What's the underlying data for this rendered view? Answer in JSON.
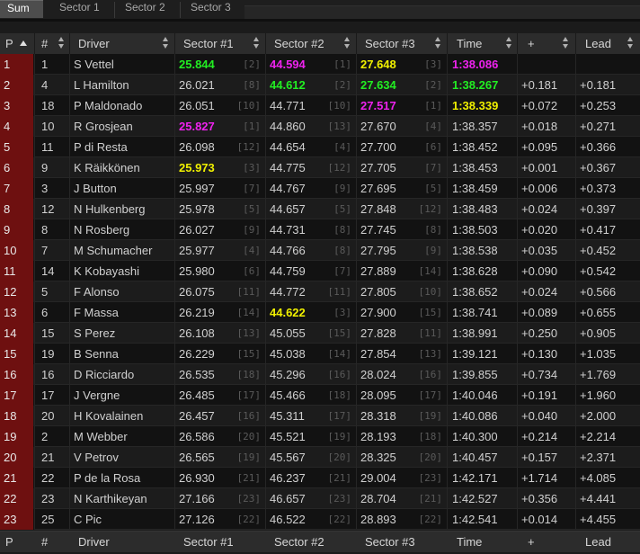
{
  "tabs": [
    "Sum",
    "Sector 1",
    "Sector 2",
    "Sector 3"
  ],
  "headers": {
    "p": "P",
    "num": "#",
    "driver": "Driver",
    "s1": "Sector #1",
    "s2": "Sector #2",
    "s3": "Sector #3",
    "time": "Time",
    "plus": "+",
    "lead": "Lead"
  },
  "colors": {
    "session_best": "#ee22ee",
    "personal_best": "#22ee22",
    "sector_yellow": "#f0f000",
    "position_bg": "#6e1010"
  },
  "rows": [
    {
      "p": "1",
      "num": "1",
      "driver": "S Vettel",
      "s1": "25.844",
      "s1r": "[2]",
      "s1c": "green",
      "s2": "44.594",
      "s2r": "[1]",
      "s2c": "purple",
      "s3": "27.648",
      "s3r": "[3]",
      "s3c": "yellow",
      "time": "1:38.086",
      "tc": "purple",
      "plus": "",
      "lead": ""
    },
    {
      "p": "2",
      "num": "4",
      "driver": "L Hamilton",
      "s1": "26.021",
      "s1r": "[8]",
      "s1c": "",
      "s2": "44.612",
      "s2r": "[2]",
      "s2c": "green",
      "s3": "27.634",
      "s3r": "[2]",
      "s3c": "green",
      "time": "1:38.267",
      "tc": "green",
      "plus": "+0.181",
      "lead": "+0.181"
    },
    {
      "p": "3",
      "num": "18",
      "driver": "P Maldonado",
      "s1": "26.051",
      "s1r": "[10]",
      "s1c": "",
      "s2": "44.771",
      "s2r": "[10]",
      "s2c": "",
      "s3": "27.517",
      "s3r": "[1]",
      "s3c": "purple",
      "time": "1:38.339",
      "tc": "yellow",
      "plus": "+0.072",
      "lead": "+0.253"
    },
    {
      "p": "4",
      "num": "10",
      "driver": "R Grosjean",
      "s1": "25.827",
      "s1r": "[1]",
      "s1c": "purple",
      "s2": "44.860",
      "s2r": "[13]",
      "s2c": "",
      "s3": "27.670",
      "s3r": "[4]",
      "s3c": "",
      "time": "1:38.357",
      "tc": "",
      "plus": "+0.018",
      "lead": "+0.271"
    },
    {
      "p": "5",
      "num": "11",
      "driver": "P di Resta",
      "s1": "26.098",
      "s1r": "[12]",
      "s1c": "",
      "s2": "44.654",
      "s2r": "[4]",
      "s2c": "",
      "s3": "27.700",
      "s3r": "[6]",
      "s3c": "",
      "time": "1:38.452",
      "tc": "",
      "plus": "+0.095",
      "lead": "+0.366"
    },
    {
      "p": "6",
      "num": "9",
      "driver": "K Räikkönen",
      "s1": "25.973",
      "s1r": "[3]",
      "s1c": "yellow",
      "s2": "44.775",
      "s2r": "[12]",
      "s2c": "",
      "s3": "27.705",
      "s3r": "[7]",
      "s3c": "",
      "time": "1:38.453",
      "tc": "",
      "plus": "+0.001",
      "lead": "+0.367"
    },
    {
      "p": "7",
      "num": "3",
      "driver": "J Button",
      "s1": "25.997",
      "s1r": "[7]",
      "s1c": "",
      "s2": "44.767",
      "s2r": "[9]",
      "s2c": "",
      "s3": "27.695",
      "s3r": "[5]",
      "s3c": "",
      "time": "1:38.459",
      "tc": "",
      "plus": "+0.006",
      "lead": "+0.373"
    },
    {
      "p": "8",
      "num": "12",
      "driver": "N Hulkenberg",
      "s1": "25.978",
      "s1r": "[5]",
      "s1c": "",
      "s2": "44.657",
      "s2r": "[5]",
      "s2c": "",
      "s3": "27.848",
      "s3r": "[12]",
      "s3c": "",
      "time": "1:38.483",
      "tc": "",
      "plus": "+0.024",
      "lead": "+0.397"
    },
    {
      "p": "9",
      "num": "8",
      "driver": "N Rosberg",
      "s1": "26.027",
      "s1r": "[9]",
      "s1c": "",
      "s2": "44.731",
      "s2r": "[8]",
      "s2c": "",
      "s3": "27.745",
      "s3r": "[8]",
      "s3c": "",
      "time": "1:38.503",
      "tc": "",
      "plus": "+0.020",
      "lead": "+0.417"
    },
    {
      "p": "10",
      "num": "7",
      "driver": "M Schumacher",
      "s1": "25.977",
      "s1r": "[4]",
      "s1c": "",
      "s2": "44.766",
      "s2r": "[8]",
      "s2c": "",
      "s3": "27.795",
      "s3r": "[9]",
      "s3c": "",
      "time": "1:38.538",
      "tc": "",
      "plus": "+0.035",
      "lead": "+0.452"
    },
    {
      "p": "11",
      "num": "14",
      "driver": "K Kobayashi",
      "s1": "25.980",
      "s1r": "[6]",
      "s1c": "",
      "s2": "44.759",
      "s2r": "[7]",
      "s2c": "",
      "s3": "27.889",
      "s3r": "[14]",
      "s3c": "",
      "time": "1:38.628",
      "tc": "",
      "plus": "+0.090",
      "lead": "+0.542"
    },
    {
      "p": "12",
      "num": "5",
      "driver": "F Alonso",
      "s1": "26.075",
      "s1r": "[11]",
      "s1c": "",
      "s2": "44.772",
      "s2r": "[11]",
      "s2c": "",
      "s3": "27.805",
      "s3r": "[10]",
      "s3c": "",
      "time": "1:38.652",
      "tc": "",
      "plus": "+0.024",
      "lead": "+0.566"
    },
    {
      "p": "13",
      "num": "6",
      "driver": "F Massa",
      "s1": "26.219",
      "s1r": "[14]",
      "s1c": "",
      "s2": "44.622",
      "s2r": "[3]",
      "s2c": "yellow",
      "s3": "27.900",
      "s3r": "[15]",
      "s3c": "",
      "time": "1:38.741",
      "tc": "",
      "plus": "+0.089",
      "lead": "+0.655"
    },
    {
      "p": "14",
      "num": "15",
      "driver": "S Perez",
      "s1": "26.108",
      "s1r": "[13]",
      "s1c": "",
      "s2": "45.055",
      "s2r": "[15]",
      "s2c": "",
      "s3": "27.828",
      "s3r": "[11]",
      "s3c": "",
      "time": "1:38.991",
      "tc": "",
      "plus": "+0.250",
      "lead": "+0.905"
    },
    {
      "p": "15",
      "num": "19",
      "driver": "B Senna",
      "s1": "26.229",
      "s1r": "[15]",
      "s1c": "",
      "s2": "45.038",
      "s2r": "[14]",
      "s2c": "",
      "s3": "27.854",
      "s3r": "[13]",
      "s3c": "",
      "time": "1:39.121",
      "tc": "",
      "plus": "+0.130",
      "lead": "+1.035"
    },
    {
      "p": "16",
      "num": "16",
      "driver": "D Ricciardo",
      "s1": "26.535",
      "s1r": "[18]",
      "s1c": "",
      "s2": "45.296",
      "s2r": "[16]",
      "s2c": "",
      "s3": "28.024",
      "s3r": "[16]",
      "s3c": "",
      "time": "1:39.855",
      "tc": "",
      "plus": "+0.734",
      "lead": "+1.769"
    },
    {
      "p": "17",
      "num": "17",
      "driver": "J Vergne",
      "s1": "26.485",
      "s1r": "[17]",
      "s1c": "",
      "s2": "45.466",
      "s2r": "[18]",
      "s2c": "",
      "s3": "28.095",
      "s3r": "[17]",
      "s3c": "",
      "time": "1:40.046",
      "tc": "",
      "plus": "+0.191",
      "lead": "+1.960"
    },
    {
      "p": "18",
      "num": "20",
      "driver": "H Kovalainen",
      "s1": "26.457",
      "s1r": "[16]",
      "s1c": "",
      "s2": "45.311",
      "s2r": "[17]",
      "s2c": "",
      "s3": "28.318",
      "s3r": "[19]",
      "s3c": "",
      "time": "1:40.086",
      "tc": "",
      "plus": "+0.040",
      "lead": "+2.000"
    },
    {
      "p": "19",
      "num": "2",
      "driver": "M Webber",
      "s1": "26.586",
      "s1r": "[20]",
      "s1c": "",
      "s2": "45.521",
      "s2r": "[19]",
      "s2c": "",
      "s3": "28.193",
      "s3r": "[18]",
      "s3c": "",
      "time": "1:40.300",
      "tc": "",
      "plus": "+0.214",
      "lead": "+2.214"
    },
    {
      "p": "20",
      "num": "21",
      "driver": "V Petrov",
      "s1": "26.565",
      "s1r": "[19]",
      "s1c": "",
      "s2": "45.567",
      "s2r": "[20]",
      "s2c": "",
      "s3": "28.325",
      "s3r": "[20]",
      "s3c": "",
      "time": "1:40.457",
      "tc": "",
      "plus": "+0.157",
      "lead": "+2.371"
    },
    {
      "p": "21",
      "num": "22",
      "driver": "P de la Rosa",
      "s1": "26.930",
      "s1r": "[21]",
      "s1c": "",
      "s2": "46.237",
      "s2r": "[21]",
      "s2c": "",
      "s3": "29.004",
      "s3r": "[23]",
      "s3c": "",
      "time": "1:42.171",
      "tc": "",
      "plus": "+1.714",
      "lead": "+4.085"
    },
    {
      "p": "22",
      "num": "23",
      "driver": "N Karthikeyan",
      "s1": "27.166",
      "s1r": "[23]",
      "s1c": "",
      "s2": "46.657",
      "s2r": "[23]",
      "s2c": "",
      "s3": "28.704",
      "s3r": "[21]",
      "s3c": "",
      "time": "1:42.527",
      "tc": "",
      "plus": "+0.356",
      "lead": "+4.441"
    },
    {
      "p": "23",
      "num": "25",
      "driver": "C Pic",
      "s1": "27.126",
      "s1r": "[22]",
      "s1c": "",
      "s2": "46.522",
      "s2r": "[22]",
      "s2c": "",
      "s3": "28.893",
      "s3r": "[22]",
      "s3c": "",
      "time": "1:42.541",
      "tc": "",
      "plus": "+0.014",
      "lead": "+4.455"
    }
  ]
}
